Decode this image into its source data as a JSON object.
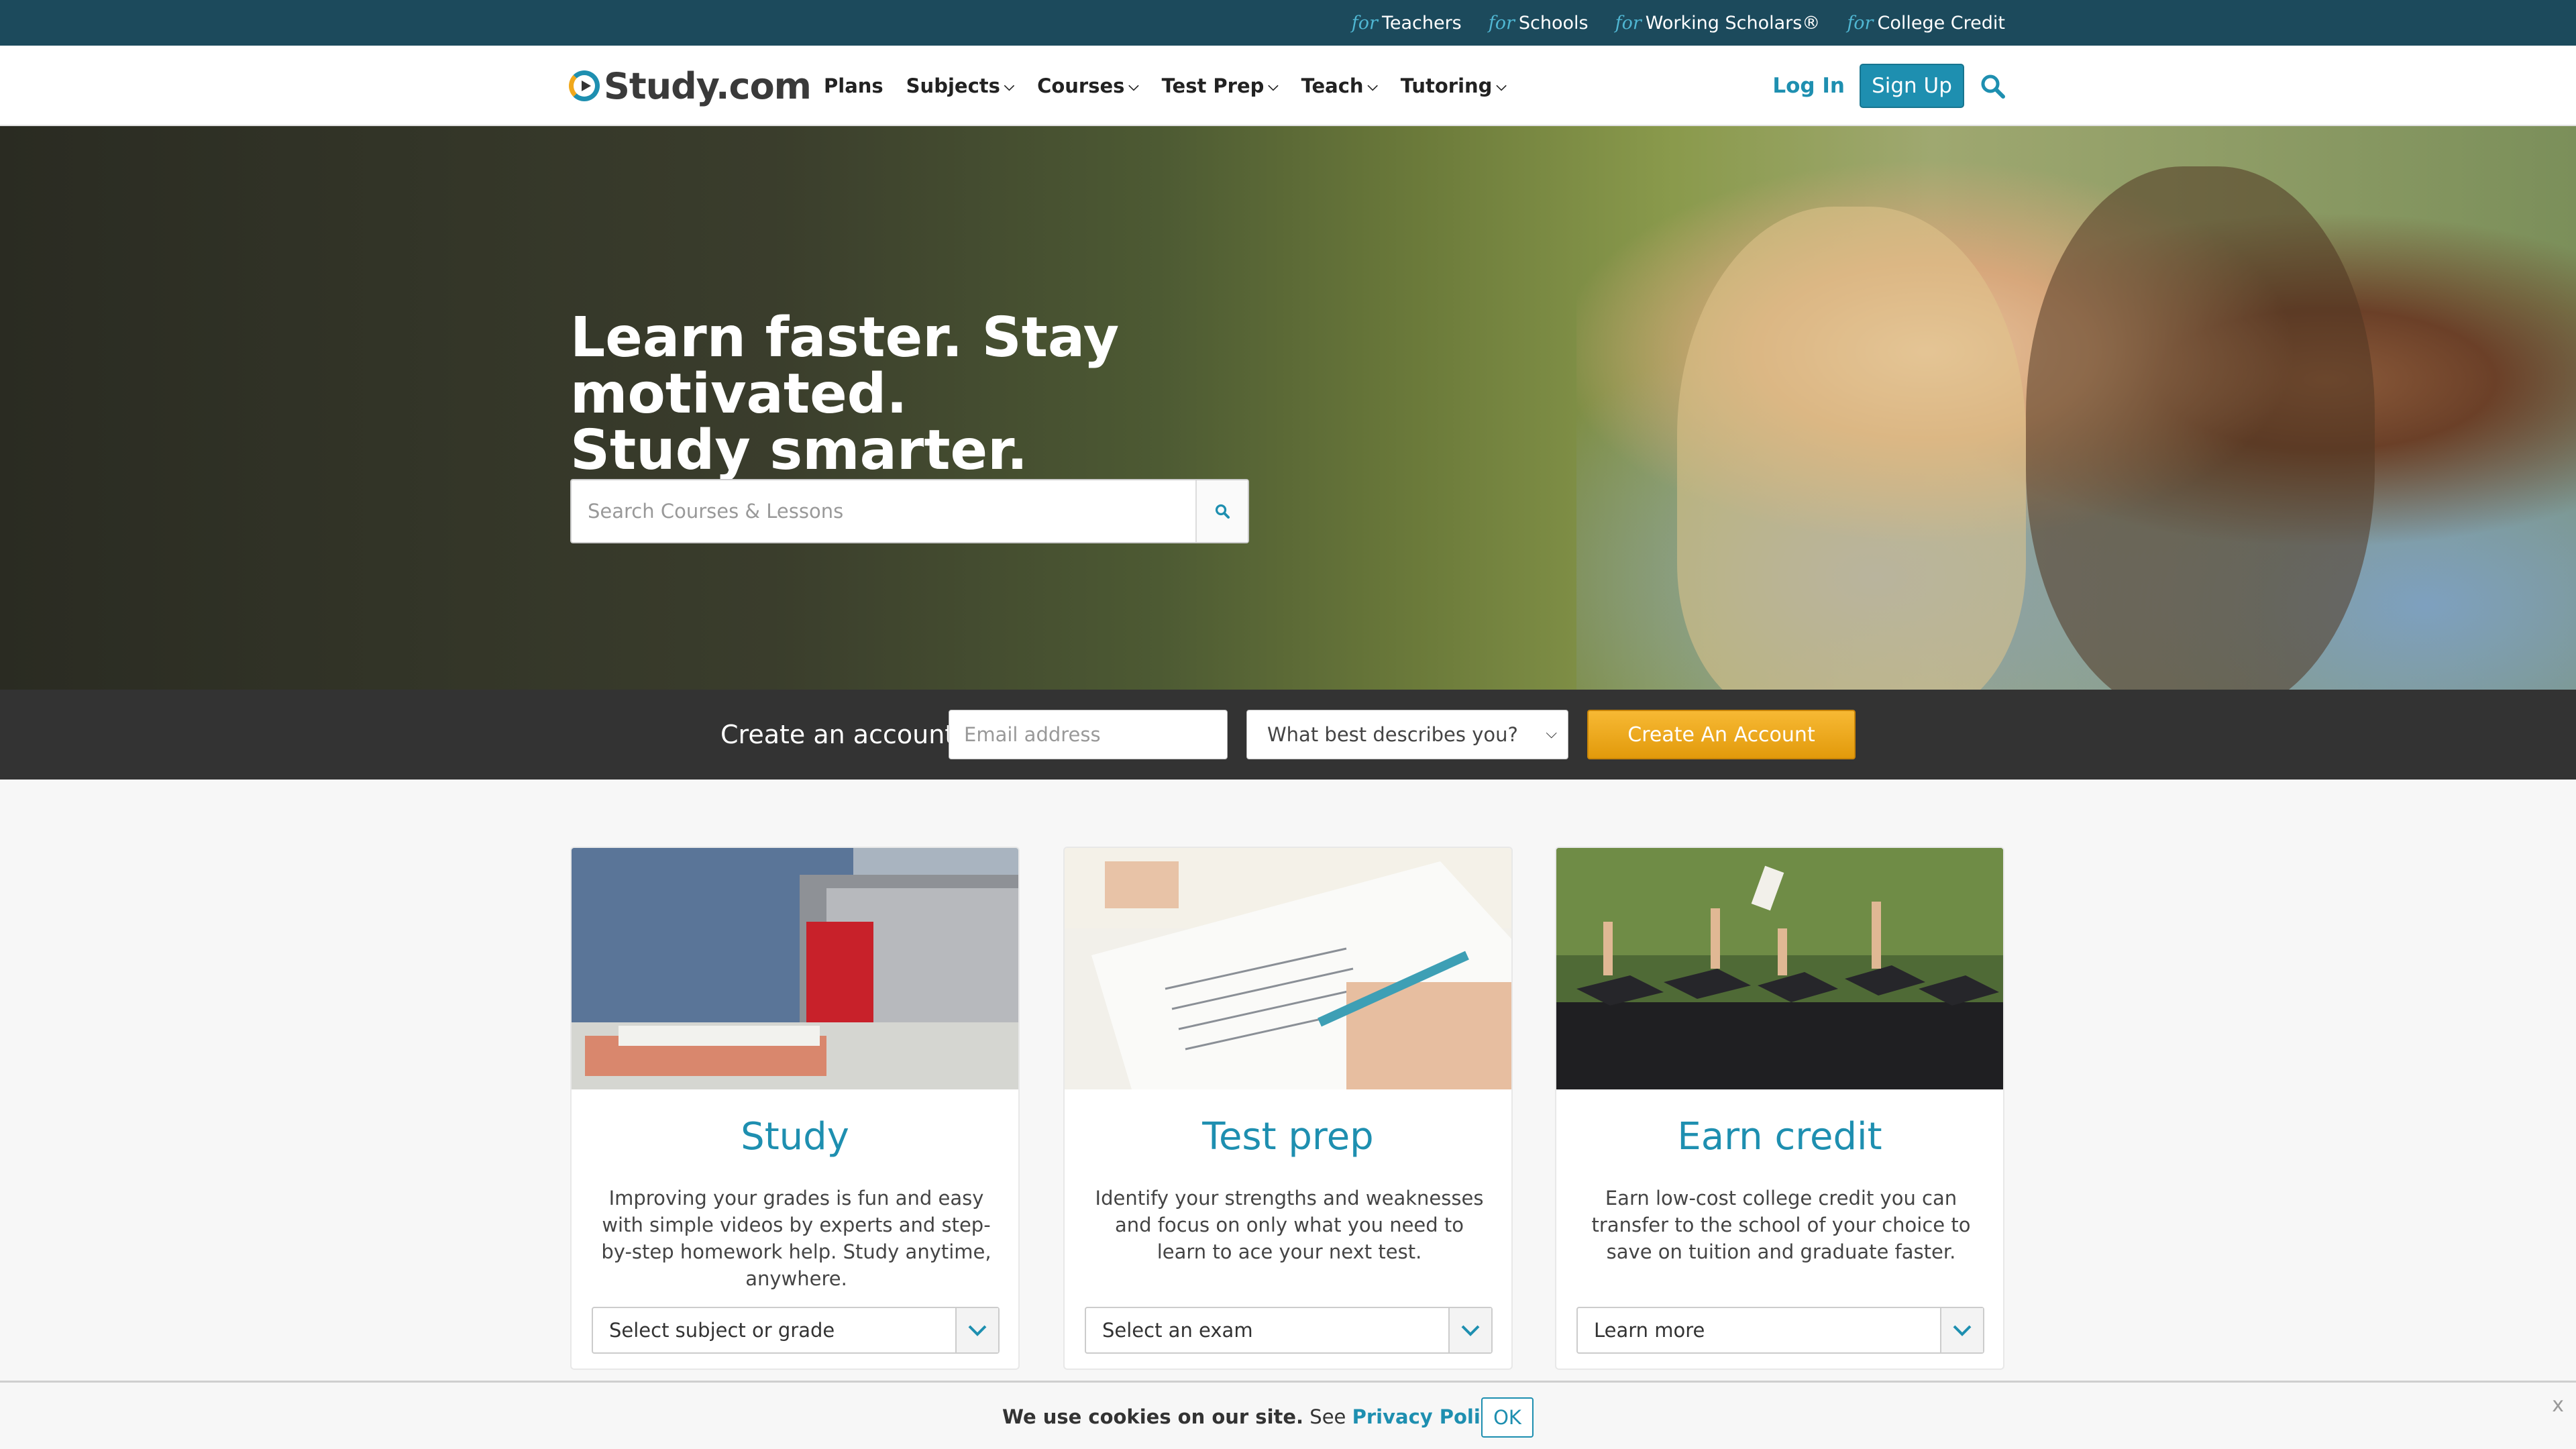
{
  "topbar": {
    "links": [
      {
        "prefix": "for",
        "label": "Teachers"
      },
      {
        "prefix": "for",
        "label": "Schools"
      },
      {
        "prefix": "for",
        "label": "Working Scholars®"
      },
      {
        "prefix": "for",
        "label": "College Credit"
      }
    ]
  },
  "navbar": {
    "logo_text": "Study.com",
    "items": [
      {
        "label": "Plans",
        "has_dropdown": false
      },
      {
        "label": "Subjects",
        "has_dropdown": true
      },
      {
        "label": "Courses",
        "has_dropdown": true
      },
      {
        "label": "Test Prep",
        "has_dropdown": true
      },
      {
        "label": "Teach",
        "has_dropdown": true
      },
      {
        "label": "Tutoring",
        "has_dropdown": true
      }
    ],
    "login_label": "Log In",
    "signup_label": "Sign Up"
  },
  "hero": {
    "title_line1": "Learn faster. Stay motivated.",
    "title_line2": "Study smarter.",
    "search_placeholder": "Search Courses & Lessons"
  },
  "account_bar": {
    "label": "Create an account",
    "email_placeholder": "Email address",
    "role_select_value": "What best describes you?",
    "create_button": "Create An Account"
  },
  "cards": [
    {
      "title": "Study",
      "description": "Improving your grades is fun and easy with simple videos by experts and step-by-step homework help. Study anytime, anywhere.",
      "select_value": "Select subject or grade"
    },
    {
      "title": "Test prep",
      "description": "Identify your strengths and weaknesses and focus on only what you need to learn to ace your next test.",
      "select_value": "Select an exam"
    },
    {
      "title": "Earn credit",
      "description": "Earn low-cost college credit you can transfer to the school of your choice to save on tuition and graduate faster.",
      "select_value": "Learn more"
    }
  ],
  "cookie_bar": {
    "text": "We use cookies on our site.",
    "see": "See",
    "link": "Privacy Policy",
    "ok_label": "OK",
    "close_label": "x"
  },
  "colors": {
    "brand": "#1e8fb0",
    "topbar": "#1c4a5c",
    "accent": "#f0a81b",
    "account_bar": "#333333"
  }
}
